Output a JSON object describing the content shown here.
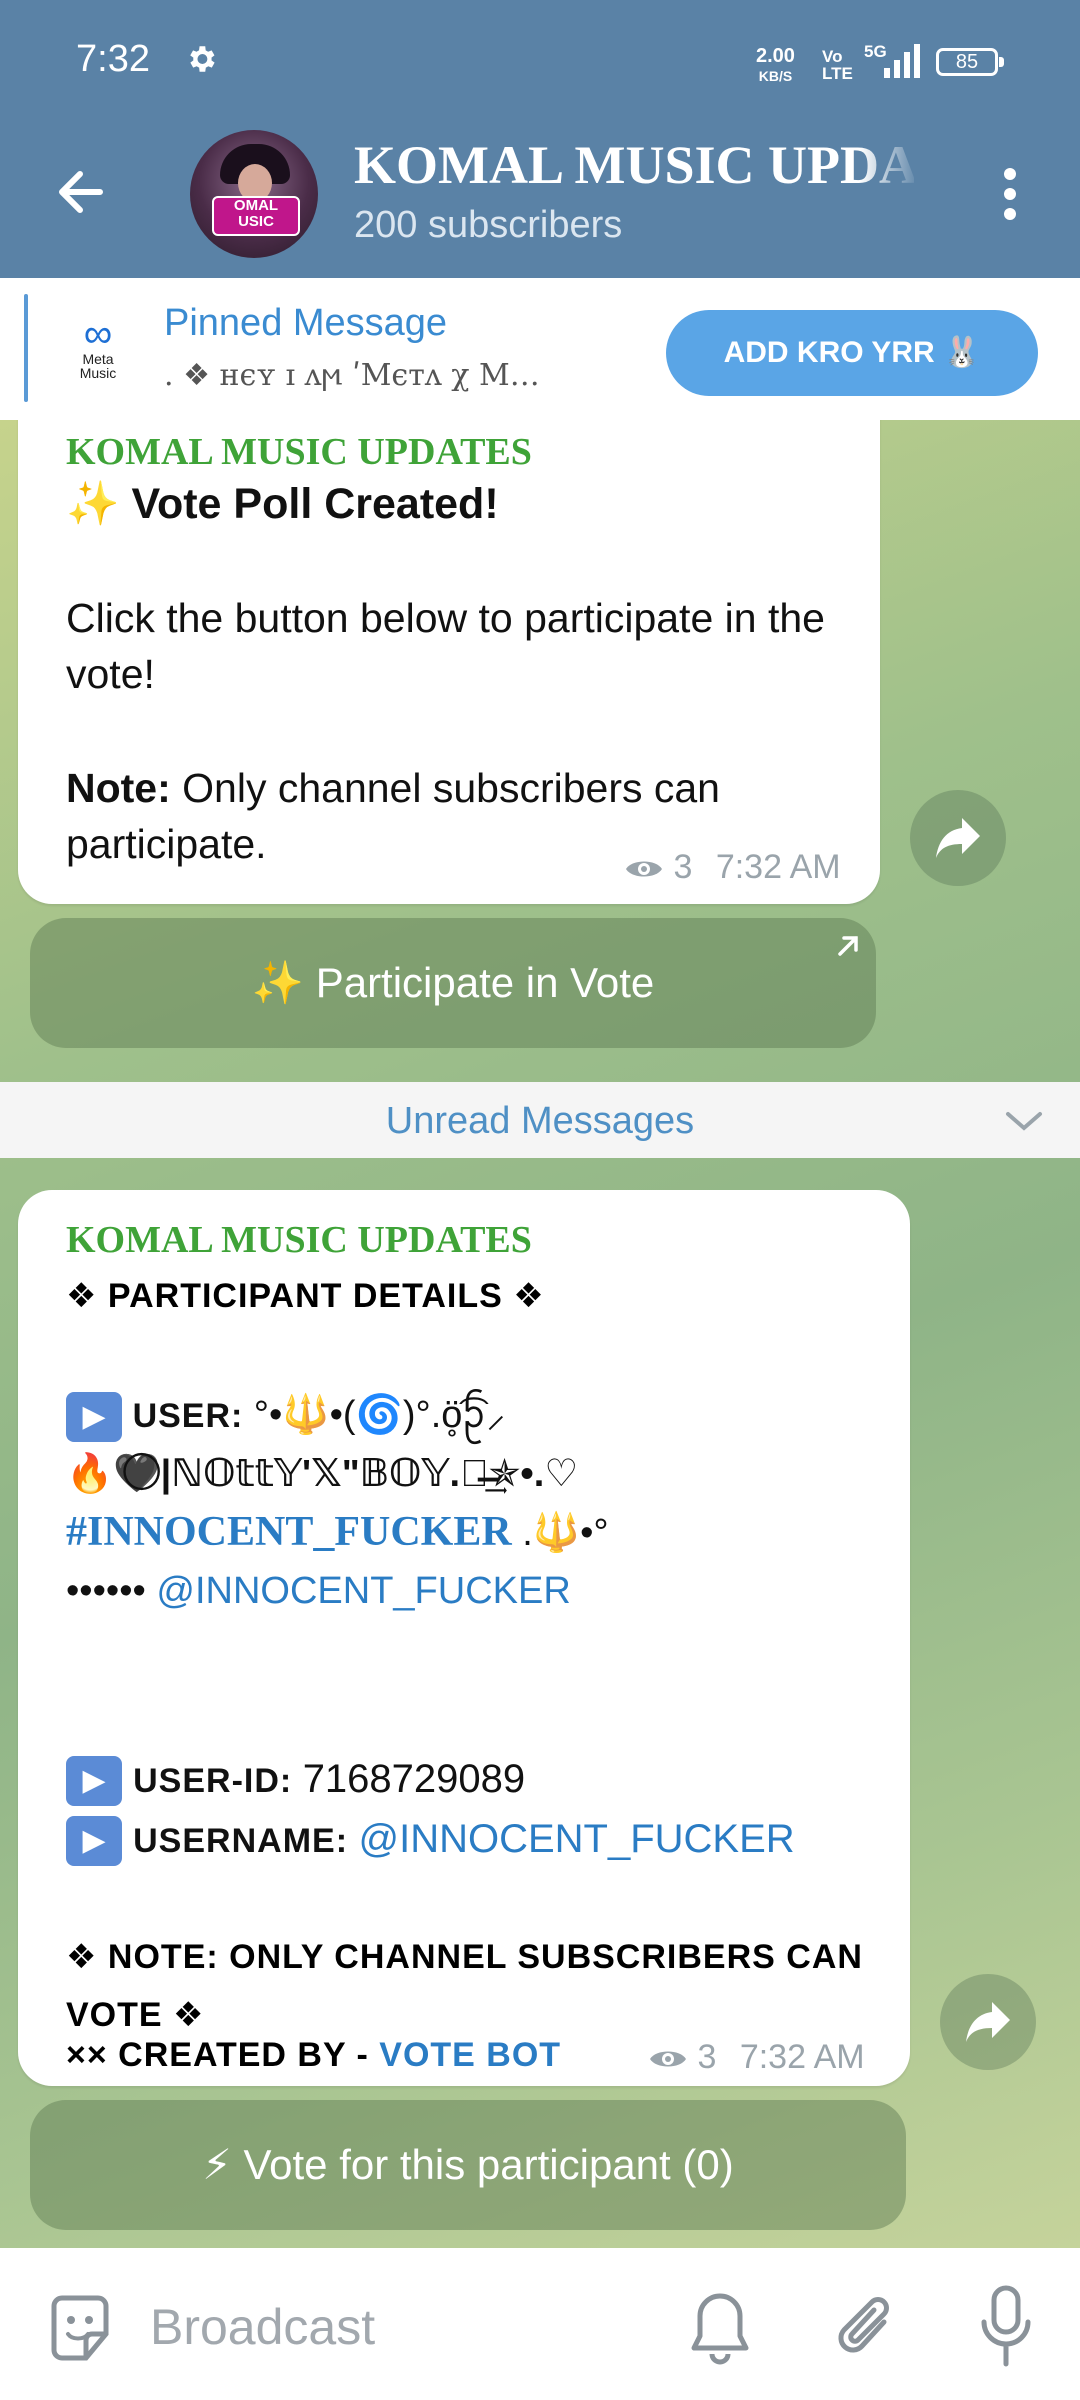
{
  "status_bar": {
    "time": "7:32",
    "speed_value": "2.00",
    "speed_unit": "KB/S",
    "volte": "Vo LTE",
    "network": "5G",
    "battery": "85"
  },
  "header": {
    "title": "KOMAL MUSIC UPDATES",
    "subtitle": "200 subscribers",
    "avatar_text_1": "OMAL",
    "avatar_text_2": "USIC"
  },
  "pinned": {
    "logo_text_1": "Meta",
    "logo_text_2": "Music",
    "label": "Pinned Message",
    "text": ". ❖ ʜєʏ ɪ ʌϻ ʹMєтʌ χ M…",
    "button_label": "ADD KRO YRR 🐰"
  },
  "messages": [
    {
      "sender": "KOMAL MUSIC UPDATES",
      "line1": "✨ Vote Poll Created!",
      "line2": "Click the button below to participate in the vote!",
      "note_label": "Note:",
      "note_text": " Only channel subscribers can participate.",
      "views": "3",
      "time": "7:32 AM",
      "button_label": "✨ Participate in Vote"
    },
    {
      "sender": "KOMAL MUSIC UPDATES",
      "header": "❖ PARTICIPANT DETAILS ❖",
      "user_label": "USER: ",
      "user_name_1": "°•🔱•(🌀)°.ö̥͡ᩐ⸝",
      "user_name_2": "🔥🖤⃝|ℕ𝕆𝕥𝕥𝕐'𝕏\"𝔹𝕆𝕐.⃝̶͢͢✯•.♡",
      "user_hashtag": "#INNOCENT_FUCKER",
      "user_hashtag_suffix": " .🔱•°",
      "user_dots": "•••••• ",
      "user_mention": "@INNOCENT_FUCKER",
      "userid_label": "USER-ID: ",
      "userid_value": "7168729089",
      "username_label": "USERNAME: ",
      "username_value": "@INNOCENT_FUCKER",
      "note": "❖ NOTE: ONLY CHANNEL SUBSCRIBERS CAN VOTE ❖",
      "created_label": "×× CREATED BY - ",
      "created_link": "VOTE BOT",
      "views": "3",
      "time": "7:32 AM",
      "button_label": "⚡ Vote for this participant (0)"
    }
  ],
  "unread_label": "Unread Messages",
  "composer": {
    "placeholder": "Broadcast"
  },
  "colors": {
    "header_bg": "#5a82a6",
    "sender_green": "#3fa338",
    "link_blue": "#2a7cc4",
    "pinned_button": "#5aa5e6"
  }
}
